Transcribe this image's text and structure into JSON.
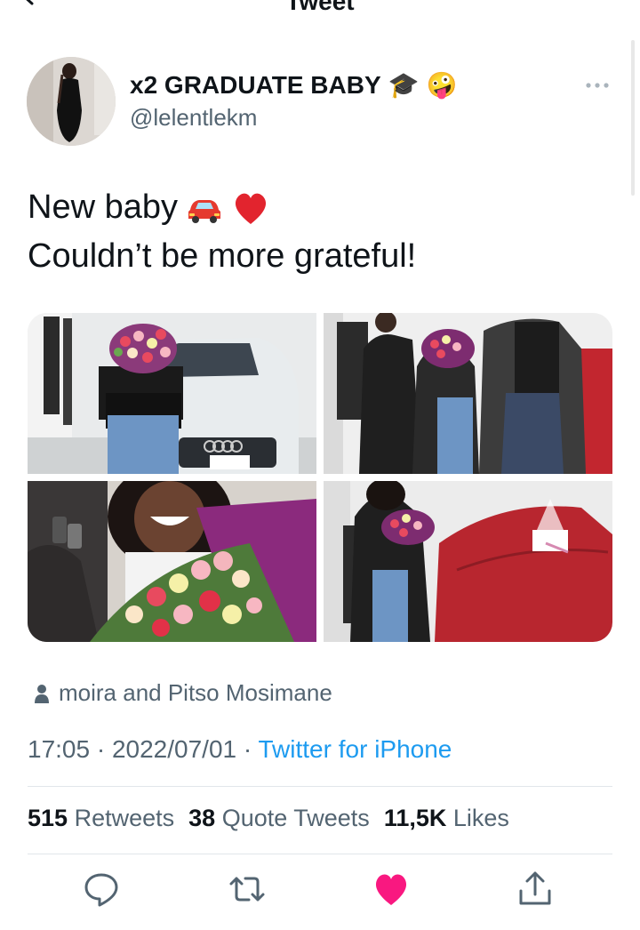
{
  "header": {
    "title": "Tweet"
  },
  "author": {
    "display_name": "x2 GRADUATE BABY",
    "name_emojis": [
      "🎓",
      "🤪"
    ],
    "handle": "@lelentlekm"
  },
  "tweet": {
    "line1": "New baby",
    "line2": "Couldn’t be more grateful!"
  },
  "media": [
    {
      "label": "woman-with-flowers-and-audi"
    },
    {
      "label": "group-photo-with-flowers"
    },
    {
      "label": "smiling-with-car-keys-and-bouquet"
    },
    {
      "label": "woman-next-to-covered-car"
    }
  ],
  "tagged": "moira and Pitso Mosimane",
  "meta": {
    "time": "17:05",
    "date": "2022/07/01",
    "separator": "·",
    "source": "Twitter for iPhone"
  },
  "stats": {
    "retweets_count": "515",
    "retweets_label": "Retweets",
    "quotes_count": "38",
    "quotes_label": "Quote Tweets",
    "likes_count": "11,5K",
    "likes_label": "Likes"
  },
  "colors": {
    "accent": "#1d9bf0",
    "like": "#f91880",
    "muted": "#536471"
  },
  "actions": [
    "reply-icon",
    "retweet-icon",
    "like-icon",
    "share-icon"
  ]
}
